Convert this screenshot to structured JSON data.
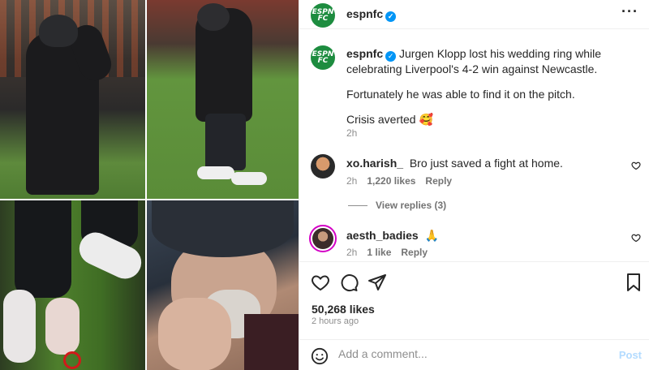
{
  "header": {
    "username": "espnfc",
    "avatar_text": "ESPN FC",
    "verified_icon": "verified-badge-icon",
    "more_icon": "more-options-icon"
  },
  "caption": {
    "username": "espnfc",
    "line1": "Jurgen Klopp lost his wedding ring while celebrating Liverpool's 4-2 win against Newcastle.",
    "line2": "Fortunately he was able to find it on the pitch.",
    "line3": "Crisis averted 🥰",
    "time": "2h"
  },
  "comments": [
    {
      "username": "xo.harish_",
      "text": "Bro just saved a fight at home.",
      "time": "2h",
      "likes": "1,220 likes",
      "reply": "Reply"
    },
    {
      "username": "aesth_badies",
      "text": "🙏",
      "time": "2h",
      "likes": "1 like",
      "reply": "Reply"
    }
  ],
  "view_replies": "View replies (3)",
  "post_stats": {
    "likes": "50,268 likes",
    "age": "2 hours ago"
  },
  "composer": {
    "placeholder": "Add a comment...",
    "post_label": "Post"
  },
  "colors": {
    "brand": "#1d8c3f",
    "verified": "#0095f6",
    "highlight_ring": "#d01a1a"
  }
}
